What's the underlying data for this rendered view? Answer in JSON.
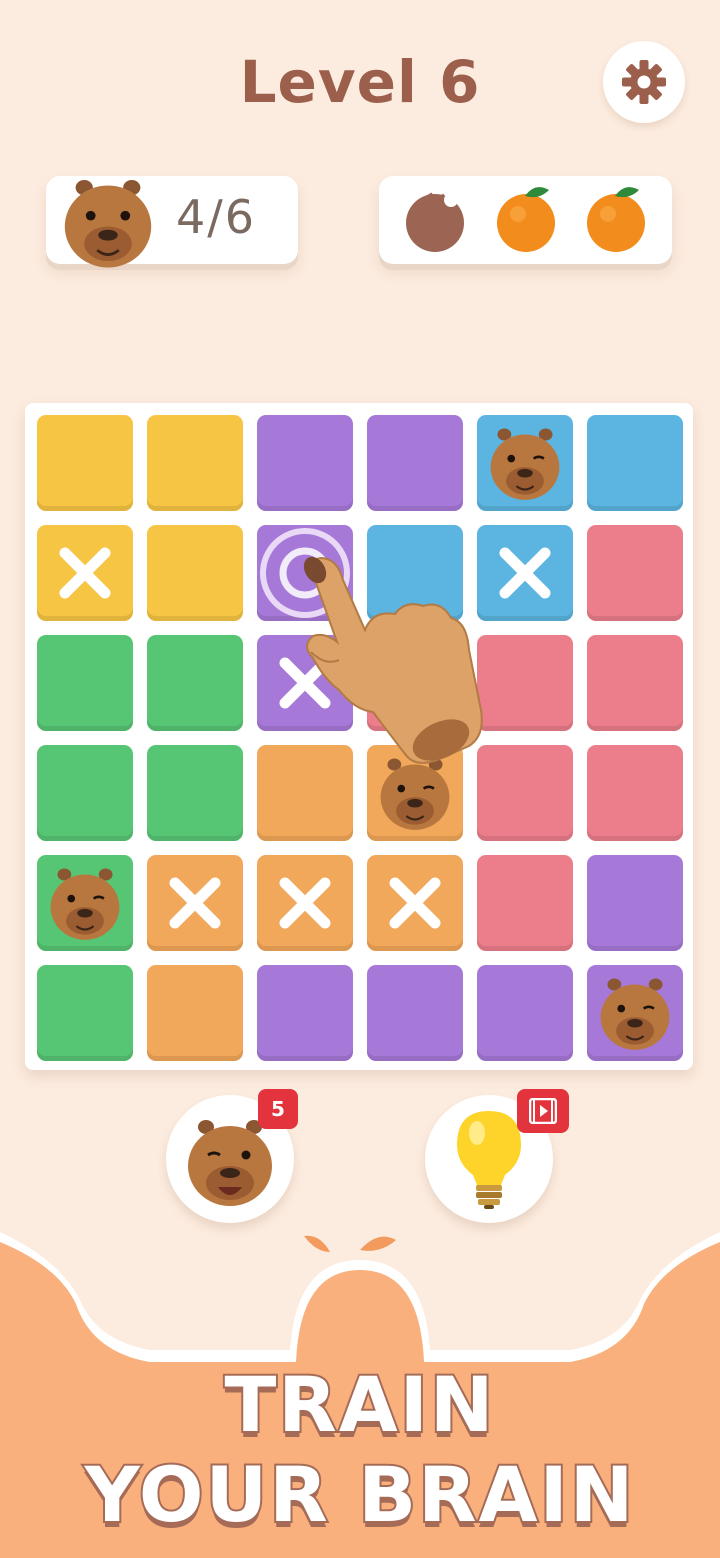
{
  "header": {
    "level_title": "Level 6"
  },
  "progress": {
    "label": "4/6"
  },
  "fruits": [
    {
      "state": "eaten"
    },
    {
      "state": "full"
    },
    {
      "state": "full"
    }
  ],
  "colors": {
    "yellow": "#f6c543",
    "purple": "#a679d8",
    "blue": "#5cb5e0",
    "pink": "#ec7e8b",
    "green": "#57c674",
    "orange": "#f2a85a"
  },
  "board": {
    "rows": [
      [
        {
          "c": "yellow",
          "m": ""
        },
        {
          "c": "yellow",
          "m": ""
        },
        {
          "c": "purple",
          "m": ""
        },
        {
          "c": "purple",
          "m": ""
        },
        {
          "c": "blue",
          "m": "capybara"
        },
        {
          "c": "blue",
          "m": ""
        }
      ],
      [
        {
          "c": "yellow",
          "m": "x"
        },
        {
          "c": "yellow",
          "m": ""
        },
        {
          "c": "purple",
          "m": "target"
        },
        {
          "c": "blue",
          "m": ""
        },
        {
          "c": "blue",
          "m": "x"
        },
        {
          "c": "pink",
          "m": ""
        }
      ],
      [
        {
          "c": "green",
          "m": ""
        },
        {
          "c": "green",
          "m": ""
        },
        {
          "c": "purple",
          "m": "x"
        },
        {
          "c": "pink",
          "m": ""
        },
        {
          "c": "pink",
          "m": ""
        },
        {
          "c": "pink",
          "m": ""
        }
      ],
      [
        {
          "c": "green",
          "m": ""
        },
        {
          "c": "green",
          "m": ""
        },
        {
          "c": "orange",
          "m": ""
        },
        {
          "c": "orange",
          "m": "capybara"
        },
        {
          "c": "pink",
          "m": ""
        },
        {
          "c": "pink",
          "m": ""
        }
      ],
      [
        {
          "c": "green",
          "m": "capybara"
        },
        {
          "c": "orange",
          "m": "x"
        },
        {
          "c": "orange",
          "m": "x"
        },
        {
          "c": "orange",
          "m": "x"
        },
        {
          "c": "pink",
          "m": ""
        },
        {
          "c": "purple",
          "m": ""
        }
      ],
      [
        {
          "c": "green",
          "m": ""
        },
        {
          "c": "orange",
          "m": ""
        },
        {
          "c": "purple",
          "m": ""
        },
        {
          "c": "purple",
          "m": ""
        },
        {
          "c": "purple",
          "m": ""
        },
        {
          "c": "purple",
          "m": "capybara"
        }
      ]
    ]
  },
  "tools": {
    "capybara_hint_count": "5",
    "bulb_badge_icon": "video-icon"
  },
  "promo": {
    "line1": "TRAIN",
    "line2": "YOUR BRAIN"
  }
}
